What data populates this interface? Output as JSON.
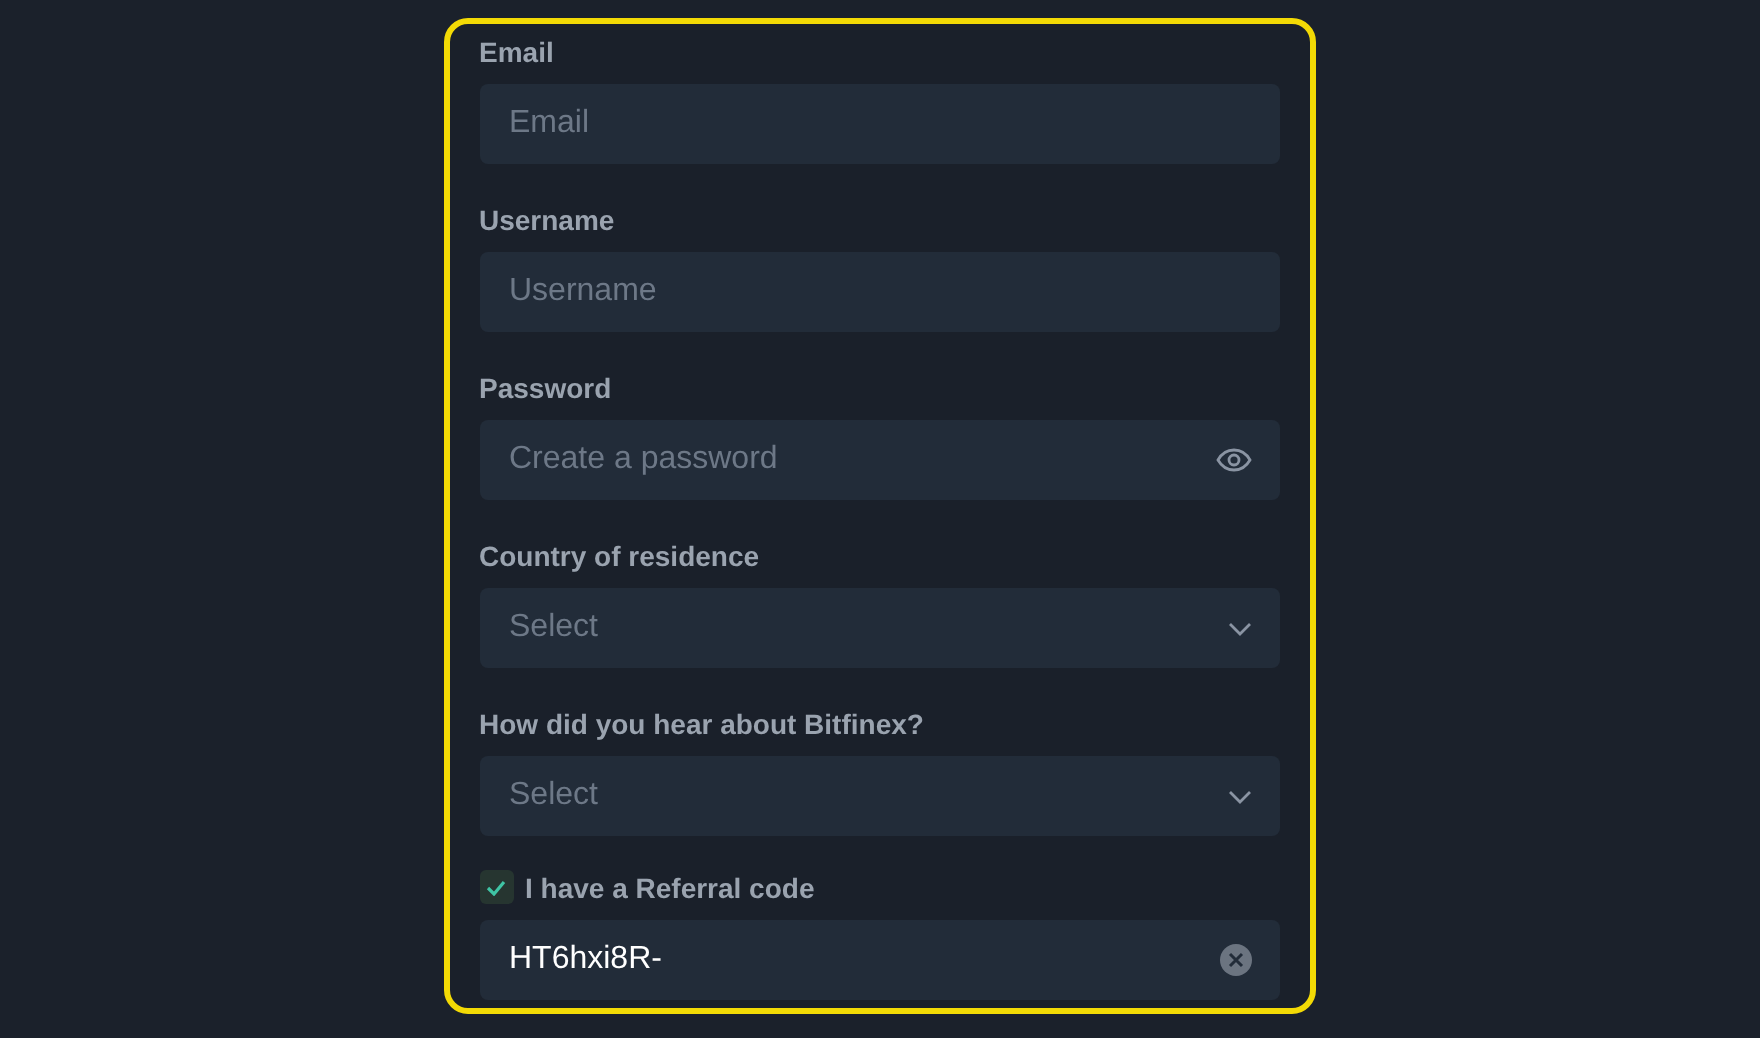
{
  "form": {
    "fields": [
      {
        "kind": "text",
        "label": "Email",
        "placeholder": "Email"
      },
      {
        "kind": "text",
        "label": "Username",
        "placeholder": "Username"
      },
      {
        "kind": "password",
        "label": "Password",
        "placeholder": "Create a password"
      },
      {
        "kind": "select",
        "label": "Country of residence",
        "placeholder": "Select"
      },
      {
        "kind": "select",
        "label": "How did you hear about Bitfinex?",
        "placeholder": "Select"
      }
    ],
    "referral": {
      "label": "I have a Referral code",
      "checked": true,
      "value": "HT6hxi8R-"
    }
  }
}
